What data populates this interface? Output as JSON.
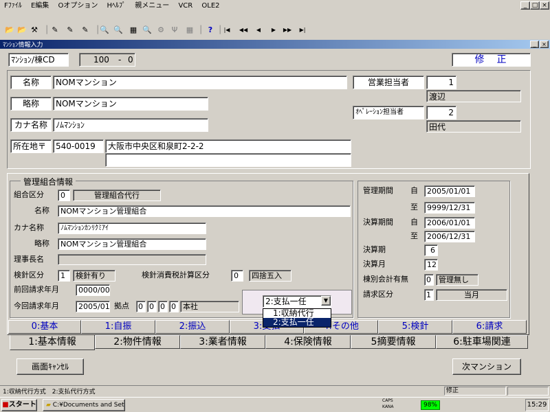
{
  "menu": [
    "Fﾌｧｲﾙ",
    "E編集",
    "Oオプション",
    "Hﾍﾙﾌﾟ",
    "親メニュー",
    "VCR",
    "OLE2"
  ],
  "window_controls": [
    "_",
    "□",
    "×"
  ],
  "inner_window_controls": [
    "_",
    "×"
  ],
  "toolbar_icons": [
    "📂",
    "📂",
    "⚒",
    "│",
    "✎",
    "✎",
    "✎",
    "│",
    "🔍",
    "🔍",
    "▦",
    "🔍",
    "⚙",
    "Ψ",
    "▦",
    "│",
    "?",
    "│",
    "|◀",
    "◀◀",
    "◀",
    "▶",
    "▶▶",
    "▶|"
  ],
  "form_title": "ﾏﾝｼｮﾝ情報入力",
  "mansion_cd_label": "ﾏﾝｼｮﾝ/棟CD",
  "mansion_cd": "100",
  "mansion_cd_sep": "-",
  "building_cd": "0",
  "mode": "修　正",
  "name_label": "名称",
  "name": "NOMマンション",
  "short_name_label": "略称",
  "short_name": "NOMマンション",
  "kana_label": "カナ名称",
  "kana": "ﾉﾑﾏﾝｼｮﾝ",
  "address_label": "所在地〒",
  "postal": "540-0019",
  "address1": "大阪市中央区和泉町2-2-2",
  "address2": "",
  "sales_label": "営業担当者",
  "sales_id": "1",
  "sales_name": "渡辺",
  "ops_label": "ｵﾍﾟﾚｰｼｮﾝ担当者",
  "ops_id": "2",
  "ops_name": "田代",
  "mgmt": {
    "group_title": "管理組合情報",
    "kubun_label": "組合区分",
    "kubun_code": "0",
    "kubun_name": "管理組合代行",
    "name_label": "名称",
    "name": "NOMマンション管理組合",
    "kana_label": "カナ名称",
    "kana": "ﾉﾑﾏﾝｼｮﾝｶﾝﾘｸﾐｱｲ",
    "short_label": "略称",
    "short": "NOMマンション管理組合",
    "chairman_label": "理事長名",
    "chairman": "",
    "meter_label": "検針区分",
    "meter_code": "1",
    "meter_name": "検針有り",
    "tax_label": "検針消費税計算区分",
    "tax_code": "0",
    "tax_name": "四捨五入",
    "prev_label": "前回請求年月",
    "prev": "0000/00",
    "curr_label": "今回請求年月",
    "curr": "2005/01",
    "base_label": "拠点",
    "base_digits": [
      "0",
      "0",
      "0",
      "0"
    ],
    "base_name": "本社",
    "payment_selected": "2:支払一任",
    "payment_options": [
      "1:収納代行",
      "2:支払一任"
    ]
  },
  "period": {
    "mgmt_label": "管理期間",
    "from_label": "自",
    "to_label": "至",
    "mgmt_from": "2005/01/01",
    "mgmt_to": "9999/12/31",
    "settle_label": "決算期間",
    "settle_from": "2006/01/01",
    "settle_to": "2006/12/31",
    "term_label": "決算期",
    "term": "6",
    "month_label": "決算月",
    "month": "12",
    "sep_label": "棟別会計有無",
    "sep_code": "0",
    "sep_name": "管理無し",
    "billing_label": "請求区分",
    "billing_code": "1",
    "billing_name": "当月"
  },
  "tabs_upper": [
    "0:基本",
    "1:自振",
    "2:振込",
    "3:支払",
    "4:その他",
    "5:検針",
    "6:請求"
  ],
  "tabs_lower": [
    "1:基本情報",
    "2:物件情報",
    "3:業者情報",
    "4:保険情報",
    "5摘要情報",
    "6:駐車場関連"
  ],
  "cancel_button": "画面ｷｬﾝｾﾙ",
  "next_button": "次マンション",
  "status_left": "1:収納代行方式　2:支払代行方式",
  "status_right": "修正",
  "taskbar": {
    "start": "スタート",
    "task": "C:¥Documents and Setti...",
    "tray_percent": "98%",
    "clock": "15:29",
    "tray_caps": "CAPS",
    "tray_kana": "KANA"
  }
}
